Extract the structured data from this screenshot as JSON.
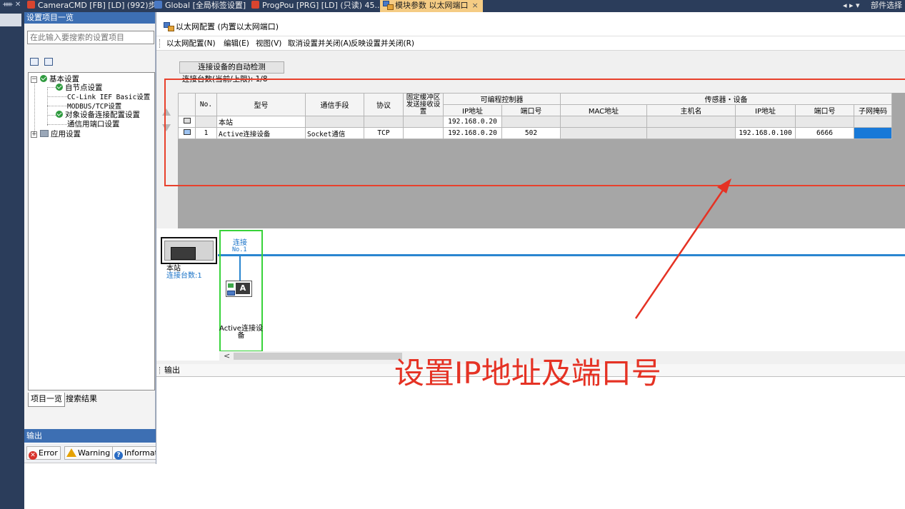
{
  "tabstrip": {
    "pin": "ᚔ ✕",
    "tabs": [
      {
        "label": "CameraCMD [FB] [LD] (992)步",
        "color": "#d9452f"
      },
      {
        "label": "Global [全局标签设置]",
        "color": "#4a79c4"
      },
      {
        "label": "ProgPou [PRG] [LD] (只读) 45...",
        "color": "#d9452f"
      },
      {
        "label": "模块参数 以太网端口",
        "color": "#4a79c4"
      }
    ],
    "active_close": "×",
    "nav_arrows": "◂ ▸ ▾",
    "right_label": "部件选择",
    "overlap_label": "设置项目"
  },
  "nav_panel": {
    "title": "设置项目一览",
    "search_placeholder": "在此输入要搜索的设置项目",
    "tree": {
      "basic": {
        "toggle": "−",
        "label": "基本设置"
      },
      "own_node": "自节点设置",
      "cclink": "CC-Link IEF Basic设置",
      "modbus": "MODBUS/TCP设置",
      "target_device": "对象设备连接配置设置",
      "comm_port": "通信用端口设置",
      "app": {
        "toggle": "+",
        "label": "应用设置"
      }
    },
    "tabs": [
      "项目一览",
      "搜索结果"
    ]
  },
  "output_panel": {
    "title": "输出",
    "buttons": [
      "Error",
      "Warning",
      "Informat"
    ]
  },
  "eth_window": {
    "title": "以太网配置 (内置以太网端口)",
    "menu": [
      "以太网配置(N)",
      "编辑(E)",
      "视图(V)",
      "取消设置并关闭(A)",
      "反映设置并关闭(R)"
    ],
    "auto_detect_label": "连接设备的自动检测",
    "conn_count_label": "连接台数(当前/上限): 1/8",
    "table": {
      "group_plc": "可编程控制器",
      "group_sensor": "传感器・设备",
      "headers": {
        "no": "No.",
        "model": "型号",
        "comm_method": "通信手段",
        "protocol": "协议",
        "fixed_buffer": "固定缓冲区",
        "fixed_buffer_2": "发送接收设置",
        "plc_ip": "IP地址",
        "plc_port": "端口号",
        "mac": "MAC地址",
        "host": "主机名",
        "dev_ip": "IP地址",
        "dev_port": "端口号",
        "subnet": "子网掩码"
      },
      "rows": [
        {
          "no": "",
          "model": "本站",
          "comm": "",
          "protocol": "",
          "fixed": "",
          "plc_ip": "192.168.0.20",
          "plc_port": "",
          "mac": "",
          "host": "",
          "dev_ip": "",
          "dev_port": "",
          "subnet": ""
        },
        {
          "no": "1",
          "model": "Active连接设备",
          "comm": "Socket通信",
          "protocol": "TCP",
          "fixed": "",
          "plc_ip": "192.168.0.20",
          "plc_port": "502",
          "mac": "",
          "host": "",
          "dev_ip": "192.168.0.100",
          "dev_port": "6666",
          "subnet": ""
        }
      ]
    },
    "diagram": {
      "station_name": "本站",
      "station_count": "连接台数:1",
      "conn_label": "连接",
      "conn_no": "No.1",
      "device_badge": "A",
      "device_label": "Active连接设备"
    },
    "output_label": "输出"
  },
  "annotation": {
    "text": "设置IP地址及端口号",
    "color": "#e53224"
  }
}
